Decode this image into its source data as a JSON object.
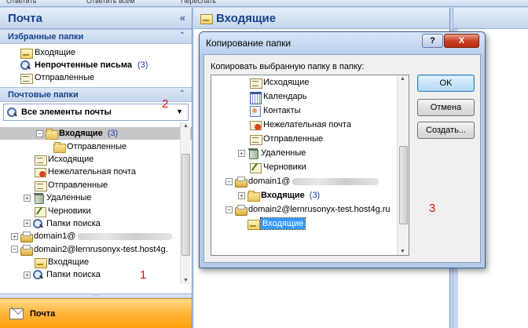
{
  "toolbar": {
    "items": [
      "Ответить",
      "Ответить всем",
      "Переслать"
    ]
  },
  "nav": {
    "title": "Почта",
    "favorites_header": "Избранные папки",
    "favorites": [
      {
        "label": "Входящие",
        "icon": "inbox-icon",
        "bold": false,
        "count": ""
      },
      {
        "label": "Непрочтенные письма",
        "icon": "search-folder-icon",
        "bold": true,
        "count": "(3)"
      },
      {
        "label": "Отправленные",
        "icon": "sent-icon",
        "bold": false,
        "count": ""
      }
    ],
    "mail_folders_header": "Почтовые папки",
    "dropdown_label": "Все элементы почты",
    "tree": [
      {
        "label": "Входящие",
        "count": "(3)",
        "bold": true,
        "selected": true,
        "icon": "folder-icon",
        "expander": "-",
        "indent": 2
      },
      {
        "label": "Отправленные",
        "count": "",
        "bold": false,
        "selected": false,
        "icon": "folder-icon",
        "expander": "",
        "indent": 3
      },
      {
        "label": "Исходящие",
        "count": "",
        "bold": false,
        "selected": false,
        "icon": "outbox-icon",
        "expander": "",
        "indent": 2
      },
      {
        "label": "Нежелательная почта",
        "count": "",
        "bold": false,
        "selected": false,
        "icon": "junk-icon",
        "expander": "",
        "indent": 2
      },
      {
        "label": "Отправленные",
        "count": "",
        "bold": false,
        "selected": false,
        "icon": "sent-icon",
        "expander": "",
        "indent": 2
      },
      {
        "label": "Удаленные",
        "count": "",
        "bold": false,
        "selected": false,
        "icon": "trash-icon",
        "expander": "+",
        "indent": 2
      },
      {
        "label": "Черновики",
        "count": "",
        "bold": false,
        "selected": false,
        "icon": "draft-icon",
        "expander": "",
        "indent": 2
      },
      {
        "label": "Папки поиска",
        "count": "",
        "bold": false,
        "selected": false,
        "icon": "search-folder-icon",
        "expander": "+",
        "indent": 2
      },
      {
        "label": "domain1@",
        "count": "",
        "bold": false,
        "selected": false,
        "icon": "mailbox-icon",
        "expander": "+",
        "indent": 0,
        "blurred": true
      },
      {
        "label": "domain2@lernrusonyx-test.host4g.",
        "count": "",
        "bold": false,
        "selected": false,
        "icon": "mailbox-icon",
        "expander": "-",
        "indent": 0
      },
      {
        "label": "Входящие",
        "count": "",
        "bold": false,
        "selected": false,
        "icon": "inbox-icon",
        "expander": "",
        "indent": 1
      },
      {
        "label": "Папки поиска",
        "count": "",
        "bold": false,
        "selected": false,
        "icon": "search-folder-icon",
        "expander": "+",
        "indent": 1
      }
    ],
    "bottom_button": "Почта"
  },
  "middle": {
    "title": "Входящие"
  },
  "annotations": {
    "n1": "1",
    "n2": "2",
    "n3": "3"
  },
  "dialog": {
    "title": "Копирование папки",
    "help_label": "?",
    "close_label": "X",
    "prompt": "Копировать выбранную папку в папку:",
    "tree": [
      {
        "label": "Исходящие",
        "count": "",
        "bold": false,
        "icon": "outbox-icon",
        "expander": "",
        "indent": 2
      },
      {
        "label": "Календарь",
        "count": "",
        "bold": false,
        "icon": "calendar-icon",
        "expander": "",
        "indent": 2
      },
      {
        "label": "Контакты",
        "count": "",
        "bold": false,
        "icon": "contacts-icon",
        "expander": "",
        "indent": 2
      },
      {
        "label": "Нежелательная почта",
        "count": "",
        "bold": false,
        "icon": "junk-icon",
        "expander": "",
        "indent": 2
      },
      {
        "label": "Отправленные",
        "count": "",
        "bold": false,
        "icon": "sent-icon",
        "expander": "",
        "indent": 2
      },
      {
        "label": "Удаленные",
        "count": "",
        "bold": false,
        "icon": "trash-icon",
        "expander": "+",
        "indent": 1
      },
      {
        "label": "Черновики",
        "count": "",
        "bold": false,
        "icon": "draft-icon",
        "expander": "",
        "indent": 2
      },
      {
        "label": "domain1@",
        "count": "",
        "bold": false,
        "icon": "mailbox-icon",
        "expander": "-",
        "indent": 0,
        "blurred": true
      },
      {
        "label": "Входящие",
        "count": "(3)",
        "bold": true,
        "icon": "folder-icon",
        "expander": "+",
        "indent": 1
      },
      {
        "label": "domain2@lernrusonyx-test.host4g.ru",
        "count": "",
        "bold": false,
        "icon": "mailbox-icon",
        "expander": "-",
        "indent": 0
      },
      {
        "label": "Входящие",
        "count": "",
        "bold": false,
        "icon": "inbox-icon",
        "expander": "",
        "indent": 1,
        "selected": true
      }
    ],
    "buttons": {
      "ok": "OK",
      "cancel": "Отмена",
      "create": "Создать..."
    }
  }
}
